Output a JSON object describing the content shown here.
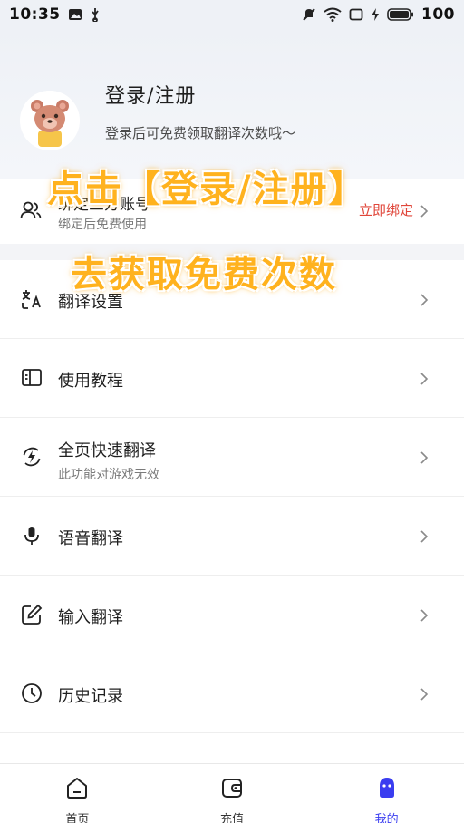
{
  "status_bar": {
    "time": "10:35",
    "battery": "100",
    "icons": [
      "gallery-icon",
      "usb-icon",
      "mute-icon",
      "wifi-icon",
      "screen-icon",
      "charging-icon",
      "battery-icon"
    ]
  },
  "profile": {
    "title": "登录/注册",
    "subtitle": "登录后可免费领取翻译次数哦～",
    "avatar": "bear-avatar"
  },
  "bind": {
    "title": "绑定三方账号",
    "subtitle": "绑定后免费使用",
    "action": "立即绑定",
    "icon": "users-icon"
  },
  "promo": {
    "line1": "点击【登录/注册】",
    "line2": "去获取免费次数"
  },
  "menu": [
    {
      "label": "翻译设置",
      "icon": "translate-settings-icon",
      "sub": ""
    },
    {
      "label": "使用教程",
      "icon": "book-icon",
      "sub": ""
    },
    {
      "label": "全页快速翻译",
      "icon": "fast-translate-icon",
      "sub": "此功能对游戏无效"
    },
    {
      "label": "语音翻译",
      "icon": "microphone-icon",
      "sub": ""
    },
    {
      "label": "输入翻译",
      "icon": "edit-icon",
      "sub": ""
    },
    {
      "label": "历史记录",
      "icon": "clock-icon",
      "sub": ""
    }
  ],
  "tabs": [
    {
      "label": "首页",
      "icon": "home-icon",
      "active": false
    },
    {
      "label": "充值",
      "icon": "wallet-icon",
      "active": false
    },
    {
      "label": "我的",
      "icon": "profile-icon",
      "active": true
    }
  ],
  "colors": {
    "accent": "#3a3df0",
    "bind_action": "#e0463a",
    "promo": "#ffb21e",
    "header_bg": "#eef1f6"
  }
}
